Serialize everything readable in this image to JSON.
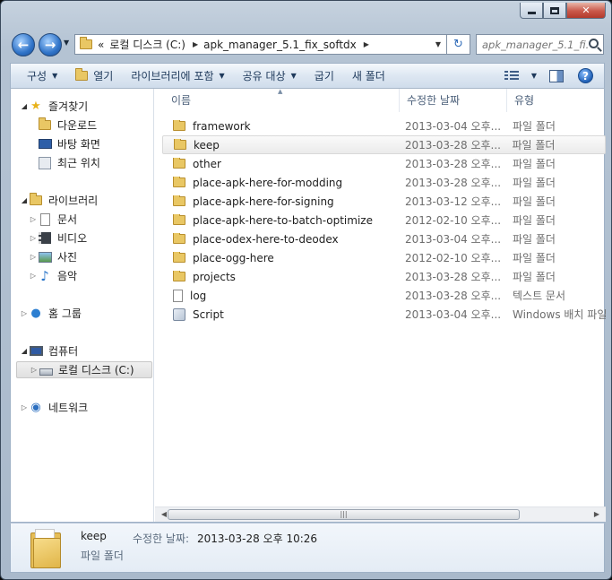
{
  "window": {
    "minimize_glyph": "",
    "close_glyph": "✕"
  },
  "address": {
    "crumb_prefix": "«",
    "crumbs": [
      "로컬 디스크 (C:)",
      "apk_manager_5.1_fix_softdx"
    ],
    "search_placeholder": "apk_manager_5.1_fi..."
  },
  "toolbar": {
    "organize": "구성",
    "open": "열기",
    "include_library": "라이브러리에 포함",
    "share": "공유 대상",
    "burn": "굽기",
    "new_folder": "새 폴더"
  },
  "nav": {
    "favorites": "즐겨찾기",
    "downloads": "다운로드",
    "desktop": "바탕 화면",
    "recent": "최근 위치",
    "libraries": "라이브러리",
    "documents": "문서",
    "videos": "비디오",
    "pictures": "사진",
    "music": "음악",
    "homegroup": "홈 그룹",
    "computer": "컴퓨터",
    "local_disk": "로컬 디스크 (C:)",
    "network": "네트워크"
  },
  "columns": {
    "name": "이름",
    "date": "수정한 날짜",
    "type": "유형"
  },
  "files": [
    {
      "name": "framework",
      "date": "2013-03-04 오후...",
      "type": "파일 폴더",
      "icon": "folder-icon"
    },
    {
      "name": "keep",
      "date": "2013-03-28 오후...",
      "type": "파일 폴더",
      "icon": "folder-icon"
    },
    {
      "name": "other",
      "date": "2013-03-28 오후...",
      "type": "파일 폴더",
      "icon": "folder-icon"
    },
    {
      "name": "place-apk-here-for-modding",
      "date": "2013-03-28 오후...",
      "type": "파일 폴더",
      "icon": "folder-icon"
    },
    {
      "name": "place-apk-here-for-signing",
      "date": "2013-03-12 오후...",
      "type": "파일 폴더",
      "icon": "folder-icon"
    },
    {
      "name": "place-apk-here-to-batch-optimize",
      "date": "2012-02-10 오후...",
      "type": "파일 폴더",
      "icon": "folder-icon"
    },
    {
      "name": "place-odex-here-to-deodex",
      "date": "2013-03-04 오후...",
      "type": "파일 폴더",
      "icon": "folder-icon"
    },
    {
      "name": "place-ogg-here",
      "date": "2012-02-10 오후...",
      "type": "파일 폴더",
      "icon": "folder-icon"
    },
    {
      "name": "projects",
      "date": "2013-03-28 오후...",
      "type": "파일 폴더",
      "icon": "folder-icon"
    },
    {
      "name": "log",
      "date": "2013-03-28 오후...",
      "type": "텍스트 문서",
      "icon": "text-file-icon"
    },
    {
      "name": "Script",
      "date": "2013-03-04 오후...",
      "type": "Windows 배치 파일",
      "icon": "batch-file-icon"
    }
  ],
  "details": {
    "name": "keep",
    "date_label": "수정한 날짜:",
    "date": "2013-03-28 오후 10:26",
    "type": "파일 폴더"
  }
}
